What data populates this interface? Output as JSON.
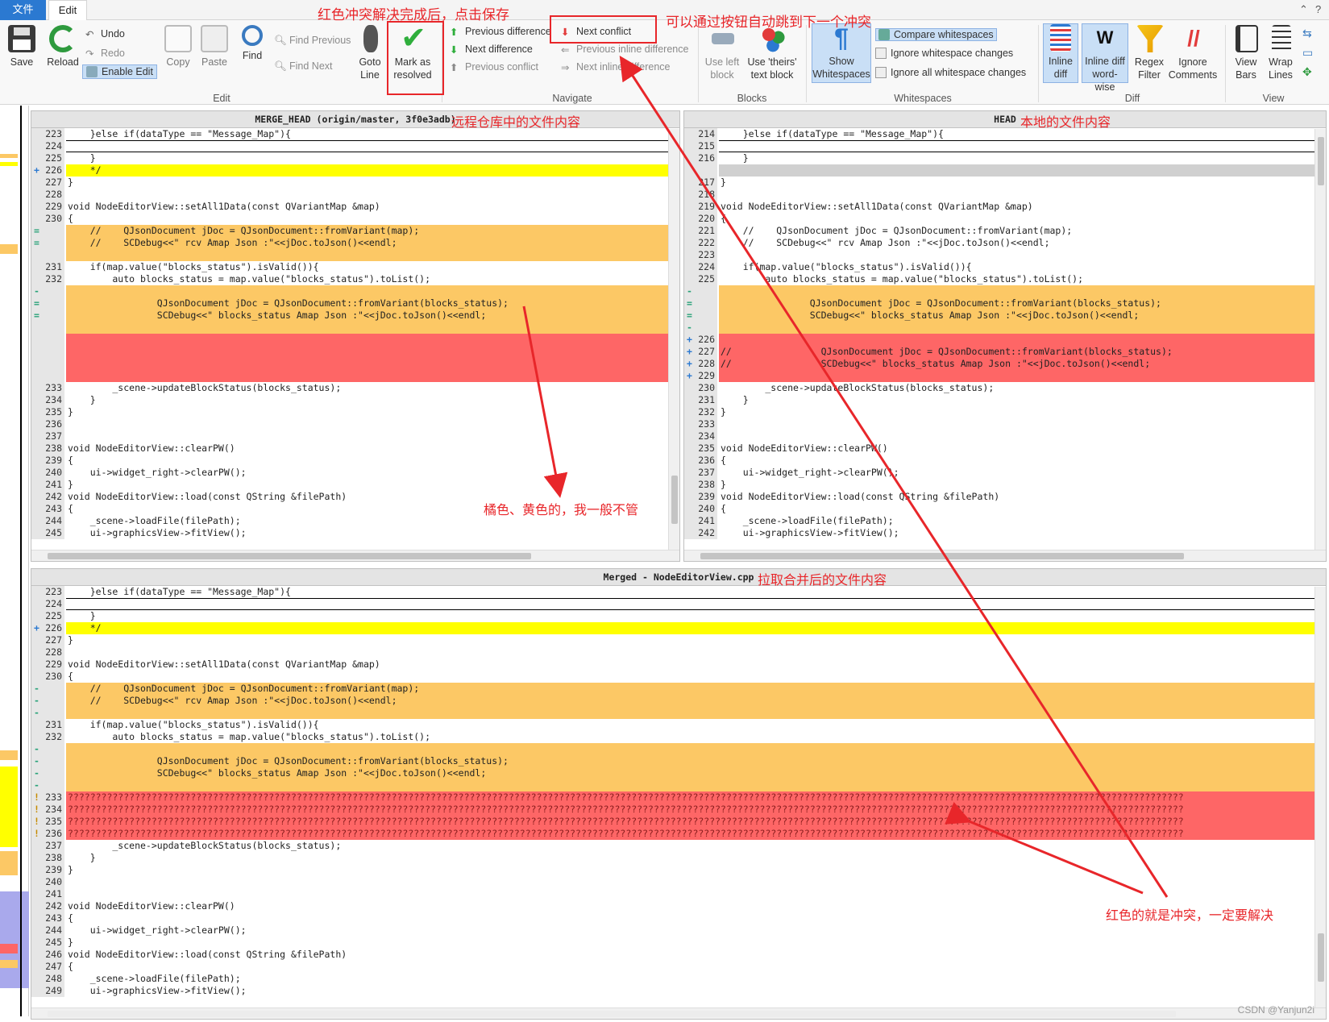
{
  "tabs": {
    "file": "文件",
    "edit": "Edit"
  },
  "window": {
    "minimize": "⌃",
    "help": "?"
  },
  "ribbon": {
    "save": "Save",
    "reload": "Reload",
    "undo": "Undo",
    "redo": "Redo",
    "enable_edit": "Enable Edit",
    "copy": "Copy",
    "paste": "Paste",
    "find": "Find",
    "find_previous": "Find Previous",
    "find_next": "Find Next",
    "goto_line": "Goto Line",
    "mark_resolved": "Mark as resolved",
    "prev_difference": "Previous difference",
    "next_difference": "Next difference",
    "prev_conflict": "Previous conflict",
    "next_conflict": "Next conflict",
    "prev_inline": "Previous inline difference",
    "next_inline": "Next inline difference",
    "use_left_block": "Use left block",
    "use_theirs": "Use 'theirs' text block",
    "show_whitespaces": "Show Whitespaces",
    "compare_whitespaces": "Compare whitespaces",
    "ignore_whitespace_changes": "Ignore whitespace changes",
    "ignore_all_whitespace": "Ignore all whitespace changes",
    "inline_diff": "Inline diff",
    "inline_diff_word": "Inline diff word-wise",
    "regex_filter": "Regex Filter",
    "ignore_comments": "Ignore Comments",
    "view_bars": "View Bars",
    "wrap_lines": "Wrap Lines",
    "groups": {
      "edit": "Edit",
      "navigate": "Navigate",
      "blocks": "Blocks",
      "whitespaces": "Whitespaces",
      "diff": "Diff",
      "view": "View"
    }
  },
  "annotations": {
    "save_note": "红色冲突解决完成后，点击保存",
    "next_conflict_note": "可以通过按钮自动跳到下一个冲突",
    "remote_note": "远程仓库中的文件内容",
    "local_note": "本地的文件内容",
    "merged_note": "拉取合并后的文件内容",
    "orange_note": "橘色、黄色的，我一般不管",
    "red_note": "红色的就是冲突，一定要解决"
  },
  "panes": {
    "left": {
      "title": "MERGE_HEAD (origin/master, 3f0e3adb)",
      "lines": [
        {
          "n": "223",
          "m": "",
          "t": "    }else if(dataType == \"Message_Map\"){",
          "c": ""
        },
        {
          "n": "224",
          "m": "",
          "t": "",
          "c": "line-sep"
        },
        {
          "n": "225",
          "m": "",
          "t": "    }",
          "c": ""
        },
        {
          "n": "226",
          "m": "+",
          "t": "    */",
          "c": "yellow"
        },
        {
          "n": "227",
          "m": "",
          "t": "}",
          "c": ""
        },
        {
          "n": "228",
          "m": "",
          "t": "",
          "c": ""
        },
        {
          "n": "229",
          "m": "",
          "t": "void NodeEditorView::setAll1Data(const QVariantMap &map)",
          "c": ""
        },
        {
          "n": "230",
          "m": "",
          "t": "{",
          "c": ""
        },
        {
          "n": "",
          "m": "=",
          "t": "    //    QJsonDocument jDoc = QJsonDocument::fromVariant(map);",
          "c": "orange"
        },
        {
          "n": "",
          "m": "=",
          "t": "    //    SCDebug<<\" rcv Amap Json :\"<<jDoc.toJson()<<endl;",
          "c": "orange"
        },
        {
          "n": "",
          "m": "",
          "t": "",
          "c": "orange"
        },
        {
          "n": "231",
          "m": "",
          "t": "    if(map.value(\"blocks_status\").isValid()){",
          "c": ""
        },
        {
          "n": "232",
          "m": "",
          "t": "        auto blocks_status = map.value(\"blocks_status\").toList();",
          "c": ""
        },
        {
          "n": "",
          "m": "-",
          "t": "",
          "c": "orange"
        },
        {
          "n": "",
          "m": "=",
          "t": "                QJsonDocument jDoc = QJsonDocument::fromVariant(blocks_status);",
          "c": "orange"
        },
        {
          "n": "",
          "m": "=",
          "t": "                SCDebug<<\" blocks_status Amap Json :\"<<jDoc.toJson()<<endl;",
          "c": "orange"
        },
        {
          "n": "",
          "m": "",
          "t": "",
          "c": "orange"
        },
        {
          "n": "",
          "m": "",
          "t": "",
          "c": "red"
        },
        {
          "n": "",
          "m": "",
          "t": "",
          "c": "red"
        },
        {
          "n": "",
          "m": "",
          "t": "",
          "c": "red"
        },
        {
          "n": "",
          "m": "",
          "t": "",
          "c": "red"
        },
        {
          "n": "233",
          "m": "",
          "t": "        _scene->updateBlockStatus(blocks_status);",
          "c": ""
        },
        {
          "n": "234",
          "m": "",
          "t": "    }",
          "c": ""
        },
        {
          "n": "235",
          "m": "",
          "t": "}",
          "c": ""
        },
        {
          "n": "236",
          "m": "",
          "t": "",
          "c": ""
        },
        {
          "n": "237",
          "m": "",
          "t": "",
          "c": ""
        },
        {
          "n": "238",
          "m": "",
          "t": "void NodeEditorView::clearPW()",
          "c": ""
        },
        {
          "n": "239",
          "m": "",
          "t": "{",
          "c": ""
        },
        {
          "n": "240",
          "m": "",
          "t": "    ui->widget_right->clearPW();",
          "c": ""
        },
        {
          "n": "241",
          "m": "",
          "t": "}",
          "c": ""
        },
        {
          "n": "242",
          "m": "",
          "t": "void NodeEditorView::load(const QString &filePath)",
          "c": ""
        },
        {
          "n": "243",
          "m": "",
          "t": "{",
          "c": ""
        },
        {
          "n": "244",
          "m": "",
          "t": "    _scene->loadFile(filePath);",
          "c": ""
        },
        {
          "n": "245",
          "m": "",
          "t": "    ui->graphicsView->fitView();",
          "c": ""
        }
      ]
    },
    "right": {
      "title": "HEAD",
      "lines": [
        {
          "n": "214",
          "m": "",
          "t": "    }else if(dataType == \"Message_Map\"){",
          "c": ""
        },
        {
          "n": "215",
          "m": "",
          "t": "",
          "c": "line-sep"
        },
        {
          "n": "216",
          "m": "",
          "t": "    }",
          "c": ""
        },
        {
          "n": "",
          "m": "",
          "t": "",
          "c": "grey"
        },
        {
          "n": "217",
          "m": "",
          "t": "}",
          "c": ""
        },
        {
          "n": "218",
          "m": "",
          "t": "",
          "c": ""
        },
        {
          "n": "219",
          "m": "",
          "t": "void NodeEditorView::setAll1Data(const QVariantMap &map)",
          "c": ""
        },
        {
          "n": "220",
          "m": "",
          "t": "{",
          "c": ""
        },
        {
          "n": "221",
          "m": "",
          "t": "    //    QJsonDocument jDoc = QJsonDocument::fromVariant(map);",
          "c": ""
        },
        {
          "n": "222",
          "m": "",
          "t": "    //    SCDebug<<\" rcv Amap Json :\"<<jDoc.toJson()<<endl;",
          "c": ""
        },
        {
          "n": "223",
          "m": "",
          "t": "",
          "c": ""
        },
        {
          "n": "224",
          "m": "",
          "t": "    if(map.value(\"blocks_status\").isValid()){",
          "c": ""
        },
        {
          "n": "225",
          "m": "",
          "t": "        auto blocks_status = map.value(\"blocks_status\").toList();",
          "c": ""
        },
        {
          "n": "",
          "m": "-",
          "t": "",
          "c": "orange"
        },
        {
          "n": "",
          "m": "=",
          "t": "                QJsonDocument jDoc = QJsonDocument::fromVariant(blocks_status);",
          "c": "orange"
        },
        {
          "n": "",
          "m": "=",
          "t": "                SCDebug<<\" blocks_status Amap Json :\"<<jDoc.toJson()<<endl;",
          "c": "orange"
        },
        {
          "n": "",
          "m": "-",
          "t": "",
          "c": "orange"
        },
        {
          "n": "226",
          "m": "+",
          "t": "",
          "c": "red"
        },
        {
          "n": "227",
          "m": "+",
          "t": "//                QJsonDocument jDoc = QJsonDocument::fromVariant(blocks_status);",
          "c": "red"
        },
        {
          "n": "228",
          "m": "+",
          "t": "//                SCDebug<<\" blocks_status Amap Json :\"<<jDoc.toJson()<<endl;",
          "c": "red"
        },
        {
          "n": "229",
          "m": "+",
          "t": "",
          "c": "red"
        },
        {
          "n": "230",
          "m": "",
          "t": "        _scene->updateBlockStatus(blocks_status);",
          "c": ""
        },
        {
          "n": "231",
          "m": "",
          "t": "    }",
          "c": ""
        },
        {
          "n": "232",
          "m": "",
          "t": "}",
          "c": ""
        },
        {
          "n": "233",
          "m": "",
          "t": "",
          "c": ""
        },
        {
          "n": "234",
          "m": "",
          "t": "",
          "c": ""
        },
        {
          "n": "235",
          "m": "",
          "t": "void NodeEditorView::clearPW()",
          "c": ""
        },
        {
          "n": "236",
          "m": "",
          "t": "{",
          "c": ""
        },
        {
          "n": "237",
          "m": "",
          "t": "    ui->widget_right->clearPW();",
          "c": ""
        },
        {
          "n": "238",
          "m": "",
          "t": "}",
          "c": ""
        },
        {
          "n": "239",
          "m": "",
          "t": "void NodeEditorView::load(const QString &filePath)",
          "c": ""
        },
        {
          "n": "240",
          "m": "",
          "t": "{",
          "c": ""
        },
        {
          "n": "241",
          "m": "",
          "t": "    _scene->loadFile(filePath);",
          "c": ""
        },
        {
          "n": "242",
          "m": "",
          "t": "    ui->graphicsView->fitView();",
          "c": ""
        }
      ]
    },
    "merged": {
      "title": "Merged - NodeEditorView.cpp",
      "lines": [
        {
          "n": "223",
          "m": "",
          "t": "    }else if(dataType == \"Message_Map\"){",
          "c": ""
        },
        {
          "n": "224",
          "m": "",
          "t": "",
          "c": "line-sep"
        },
        {
          "n": "225",
          "m": "",
          "t": "    }",
          "c": ""
        },
        {
          "n": "226",
          "m": "+",
          "t": "    */",
          "c": "yellow"
        },
        {
          "n": "227",
          "m": "",
          "t": "}",
          "c": ""
        },
        {
          "n": "228",
          "m": "",
          "t": "",
          "c": ""
        },
        {
          "n": "229",
          "m": "",
          "t": "void NodeEditorView::setAll1Data(const QVariantMap &map)",
          "c": ""
        },
        {
          "n": "230",
          "m": "",
          "t": "{",
          "c": ""
        },
        {
          "n": "",
          "m": "-",
          "t": "    //    QJsonDocument jDoc = QJsonDocument::fromVariant(map);",
          "c": "orange"
        },
        {
          "n": "",
          "m": "-",
          "t": "    //    SCDebug<<\" rcv Amap Json :\"<<jDoc.toJson()<<endl;",
          "c": "orange"
        },
        {
          "n": "",
          "m": "-",
          "t": "",
          "c": "orange"
        },
        {
          "n": "231",
          "m": "",
          "t": "    if(map.value(\"blocks_status\").isValid()){",
          "c": ""
        },
        {
          "n": "232",
          "m": "",
          "t": "        auto blocks_status = map.value(\"blocks_status\").toList();",
          "c": ""
        },
        {
          "n": "",
          "m": "-",
          "t": "",
          "c": "orange"
        },
        {
          "n": "",
          "m": "-",
          "t": "                QJsonDocument jDoc = QJsonDocument::fromVariant(blocks_status);",
          "c": "orange"
        },
        {
          "n": "",
          "m": "-",
          "t": "                SCDebug<<\" blocks_status Amap Json :\"<<jDoc.toJson()<<endl;",
          "c": "orange"
        },
        {
          "n": "",
          "m": "-",
          "t": "",
          "c": "orange"
        },
        {
          "n": "233",
          "m": "!",
          "t": "????????????????????????????????????????????????????????????????????????????????????????????????????????????????????????????????????????????????????????????????????????????????????????????????????????",
          "c": "redq"
        },
        {
          "n": "234",
          "m": "!",
          "t": "????????????????????????????????????????????????????????????????????????????????????????????????????????????????????????????????????????????????????????????????????????????????????????????????????????",
          "c": "redq"
        },
        {
          "n": "235",
          "m": "!",
          "t": "????????????????????????????????????????????????????????????????????????????????????????????????????????????????????????????????????????????????????????????????????????????????????????????????????????",
          "c": "redq"
        },
        {
          "n": "236",
          "m": "!",
          "t": "????????????????????????????????????????????????????????????????????????????????????????????????????????????????????????????????????????????????????????????????????????????????????????????????????????",
          "c": "redq"
        },
        {
          "n": "237",
          "m": "",
          "t": "        _scene->updateBlockStatus(blocks_status);",
          "c": ""
        },
        {
          "n": "238",
          "m": "",
          "t": "    }",
          "c": ""
        },
        {
          "n": "239",
          "m": "",
          "t": "}",
          "c": ""
        },
        {
          "n": "240",
          "m": "",
          "t": "",
          "c": ""
        },
        {
          "n": "241",
          "m": "",
          "t": "",
          "c": ""
        },
        {
          "n": "242",
          "m": "",
          "t": "void NodeEditorView::clearPW()",
          "c": ""
        },
        {
          "n": "243",
          "m": "",
          "t": "{",
          "c": ""
        },
        {
          "n": "244",
          "m": "",
          "t": "    ui->widget_right->clearPW();",
          "c": ""
        },
        {
          "n": "245",
          "m": "",
          "t": "}",
          "c": ""
        },
        {
          "n": "246",
          "m": "",
          "t": "void NodeEditorView::load(const QString &filePath)",
          "c": ""
        },
        {
          "n": "247",
          "m": "",
          "t": "{",
          "c": ""
        },
        {
          "n": "248",
          "m": "",
          "t": "    _scene->loadFile(filePath);",
          "c": ""
        },
        {
          "n": "249",
          "m": "",
          "t": "    ui->graphicsView->fitView();",
          "c": ""
        }
      ]
    }
  },
  "watermark": "CSDN @Yanjun2i",
  "colors": {
    "conflict": "#fe6666",
    "change": "#fcc865",
    "added": "#ffff00",
    "accent": "#2b79d1"
  }
}
